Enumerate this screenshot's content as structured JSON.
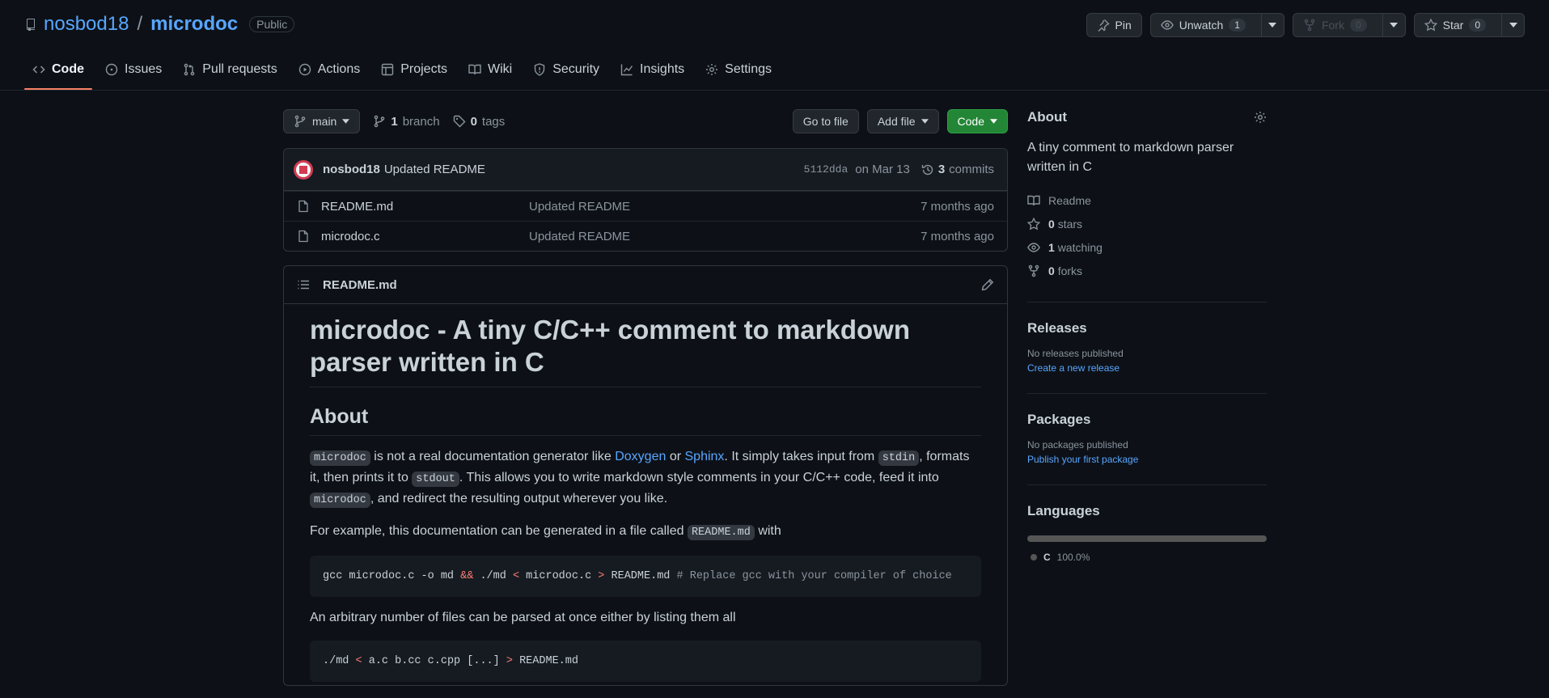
{
  "repo": {
    "owner": "nosbod18",
    "separator": "/",
    "name": "microdoc",
    "visibility": "Public"
  },
  "actions": {
    "pin": "Pin",
    "unwatch": "Unwatch",
    "watch_count": "1",
    "fork": "Fork",
    "fork_count": "0",
    "star": "Star",
    "star_count": "0"
  },
  "nav": {
    "code": "Code",
    "issues": "Issues",
    "pulls": "Pull requests",
    "actions": "Actions",
    "projects": "Projects",
    "wiki": "Wiki",
    "security": "Security",
    "insights": "Insights",
    "settings": "Settings"
  },
  "file_nav": {
    "branch": "main",
    "branch_count": "1",
    "branch_label": "branch",
    "tag_count": "0",
    "tag_label": "tags",
    "go_to_file": "Go to file",
    "add_file": "Add file",
    "code": "Code"
  },
  "commit": {
    "author": "nosbod18",
    "message": "Updated README",
    "sha": "5112dda",
    "date": "on Mar 13",
    "count": "3",
    "count_label": "commits"
  },
  "files": [
    {
      "name": "README.md",
      "message": "Updated README",
      "age": "7 months ago"
    },
    {
      "name": "microdoc.c",
      "message": "Updated README",
      "age": "7 months ago"
    }
  ],
  "readme": {
    "filename": "README.md",
    "title": "microdoc - A tiny C/C++ comment to markdown parser written in C",
    "about_heading": "About",
    "p1": {
      "code1": "microdoc",
      "t1": " is not a real documentation generator like ",
      "link1": "Doxygen",
      "t2": " or ",
      "link2": "Sphinx",
      "t3": ". It simply takes input from ",
      "code2": "stdin",
      "t4": ", formats it, then prints it to ",
      "code3": "stdout",
      "t5": ". This allows you to write markdown style comments in your C/C++ code, feed it into ",
      "code4": "microdoc",
      "t6": ", and redirect the resulting output wherever you like."
    },
    "p2": {
      "t1": "For example, this documentation can be generated in a file called ",
      "code": "README.md",
      "t2": " with"
    },
    "code1": {
      "a": "gcc microdoc.c -o md ",
      "op1": "&&",
      "b": " ./md ",
      "op2": "<",
      "c": " microdoc.c ",
      "op3": ">",
      "d": " README.md ",
      "comment": "# Replace gcc with your compiler of choice"
    },
    "p3": "An arbitrary number of files can be parsed at once either by listing them all",
    "code2": {
      "a": "./md ",
      "op1": "<",
      "b": " a.c b.cc c.cpp [...] ",
      "op2": ">",
      "c": " README.md"
    }
  },
  "sidebar": {
    "about_title": "About",
    "description": "A tiny comment to markdown parser written in C",
    "readme": "Readme",
    "stars_count": "0",
    "stars_label": "stars",
    "watching_count": "1",
    "watching_label": "watching",
    "forks_count": "0",
    "forks_label": "forks",
    "releases_title": "Releases",
    "no_releases": "No releases published",
    "create_release": "Create a new release",
    "packages_title": "Packages",
    "no_packages": "No packages published",
    "publish_package": "Publish your first package",
    "languages_title": "Languages",
    "languages": [
      {
        "name": "C",
        "percent": "100.0%",
        "fraction": 1.0,
        "color": "#555555"
      }
    ]
  },
  "colors": {
    "background": "#0d1117",
    "link": "#58a6ff",
    "primary_button": "#238636",
    "active_tab_underline": "#f78166"
  },
  "icons": {
    "repo": "repo-icon",
    "pin": "pin-icon",
    "eye": "eye-icon",
    "fork": "fork-icon",
    "star": "star-icon",
    "gear": "gear-icon"
  }
}
